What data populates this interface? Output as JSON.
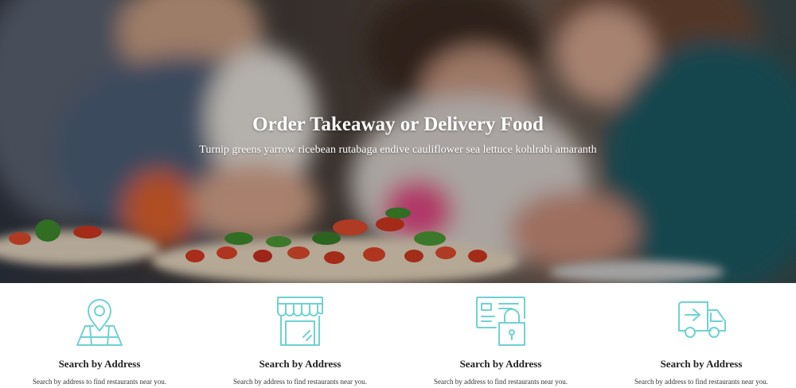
{
  "hero": {
    "title": "Order Takeaway or Delivery Food",
    "subtitle": "Turnip greens yarrow ricebean rutabaga endive cauliflower sea lettuce kohlrabi amaranth"
  },
  "features": [
    {
      "icon": "map-pin-icon",
      "title": "Search by Address",
      "text": "Search by address to find restaurants near you."
    },
    {
      "icon": "storefront-icon",
      "title": "Search by Address",
      "text": "Search by address to find restaurants near you."
    },
    {
      "icon": "secure-payment-icon",
      "title": "Search by Address",
      "text": "Search by address to find restaurants near you."
    },
    {
      "icon": "delivery-van-icon",
      "title": "Search by Address",
      "text": "Search by address to find restaurants near you."
    }
  ],
  "colors": {
    "icon_accent": "#6fd3d1",
    "title_text": "#222222",
    "body_text": "#333333",
    "hero_text": "#ffffff"
  }
}
